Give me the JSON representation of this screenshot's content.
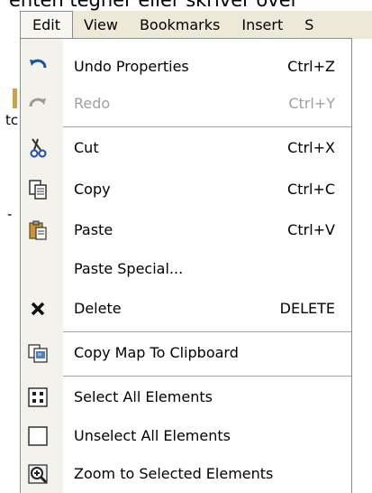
{
  "background": {
    "top_text": "enten tegner eller skriver over",
    "fragment_1": "tc",
    "fragment_2": "-"
  },
  "menubar": {
    "items": [
      {
        "label": "Edit",
        "active": true
      },
      {
        "label": "View"
      },
      {
        "label": "Bookmarks"
      },
      {
        "label": "Insert"
      },
      {
        "label": "S"
      }
    ]
  },
  "menu": {
    "items": [
      {
        "icon": "undo-icon",
        "label": "Undo  Properties",
        "shortcut": "Ctrl+Z",
        "enabled": true
      },
      {
        "icon": "redo-icon",
        "label": "Redo",
        "shortcut": "Ctrl+Y",
        "enabled": false
      },
      {
        "icon": "cut-icon",
        "label": "Cut",
        "shortcut": "Ctrl+X",
        "enabled": true
      },
      {
        "icon": "copy-icon",
        "label": "Copy",
        "shortcut": "Ctrl+C",
        "enabled": true
      },
      {
        "icon": "paste-icon",
        "label": "Paste",
        "shortcut": "Ctrl+V",
        "enabled": true
      },
      {
        "icon": "",
        "label": "Paste Special...",
        "shortcut": "",
        "enabled": true
      },
      {
        "icon": "delete-icon",
        "label": "Delete",
        "shortcut": "DELETE",
        "enabled": true
      },
      {
        "icon": "copy-map-icon",
        "label": "Copy Map To Clipboard",
        "shortcut": "",
        "enabled": true
      },
      {
        "icon": "select-all-icon",
        "label": "Select All Elements",
        "shortcut": "",
        "enabled": true
      },
      {
        "icon": "unselect-all-icon",
        "label": "Unselect All Elements",
        "shortcut": "",
        "enabled": true
      },
      {
        "icon": "zoom-selected-icon",
        "label": "Zoom to Selected Elements",
        "shortcut": "",
        "enabled": true
      }
    ]
  }
}
